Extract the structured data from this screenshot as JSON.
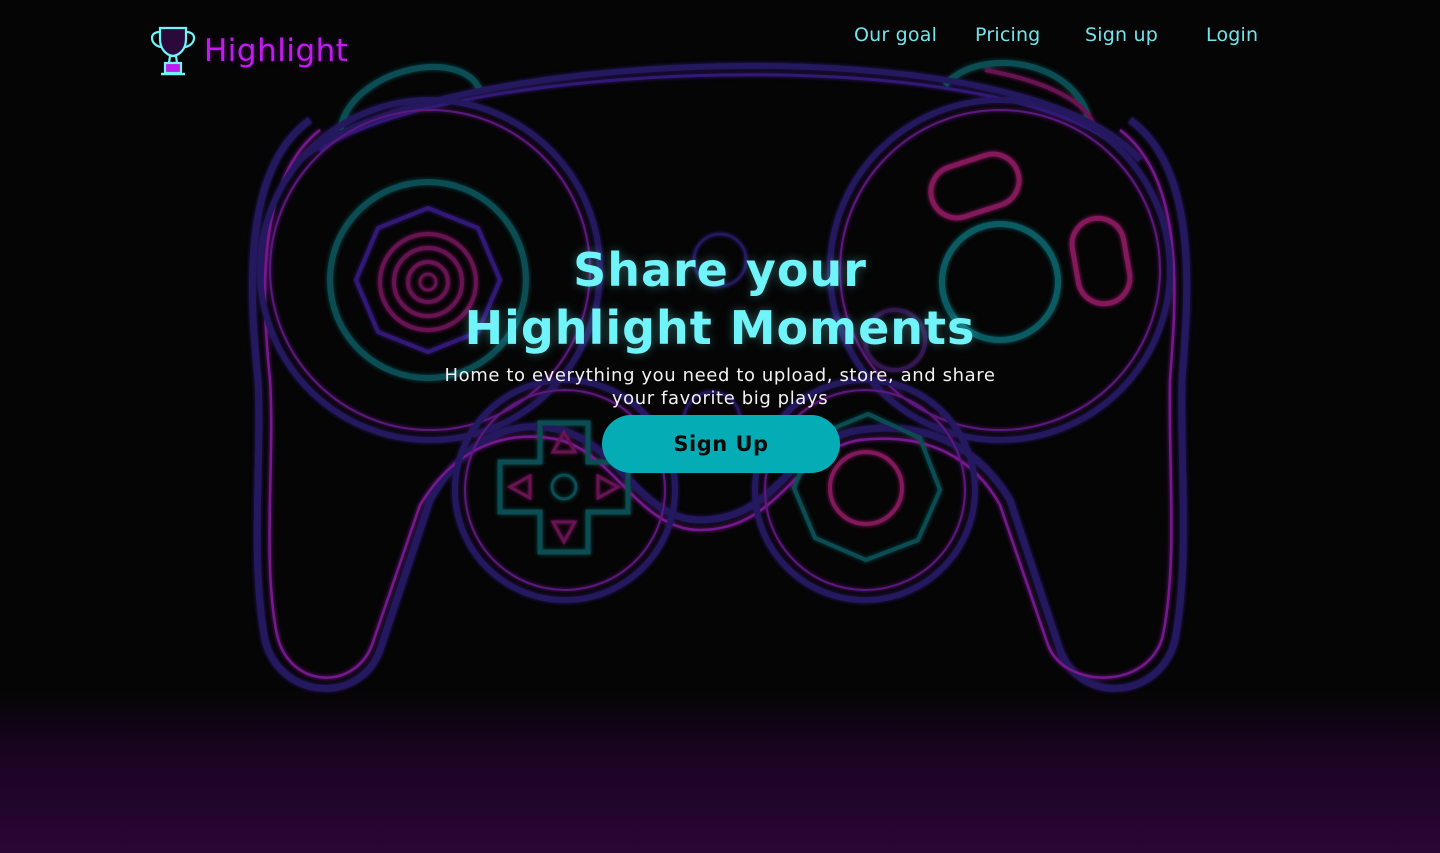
{
  "brand": {
    "name": "Highlight",
    "logo_icon": "trophy-icon",
    "accent_color": "#c21bf0"
  },
  "nav": {
    "items": [
      {
        "label": "Our goal"
      },
      {
        "label": "Pricing"
      },
      {
        "label": "Sign up"
      },
      {
        "label": "Login"
      }
    ],
    "color": "#6fe6ee"
  },
  "hero": {
    "title_line1": "Share your",
    "title_line2": "Highlight Moments",
    "subtitle_line1": "Home to everything you need to upload, store, and share",
    "subtitle_line2": "your favorite big plays",
    "cta_label": "Sign Up",
    "title_color": "#6ff4fa",
    "cta_color": "#04adb6"
  },
  "background": {
    "graphic": "game-controller-icon",
    "outline_colors": [
      "#3a1f8c",
      "#9a1fb0",
      "#0f6c73",
      "#b01f7d"
    ]
  }
}
